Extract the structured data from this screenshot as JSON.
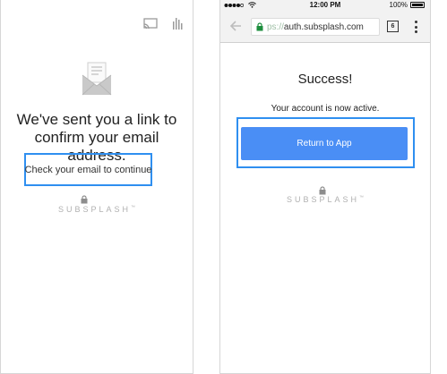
{
  "left_screen": {
    "headline": "We've sent you a link to confirm your email address.",
    "link_text": "Check your email to continue",
    "brand": "SUBSPLASH",
    "brand_mark": "™",
    "icons": [
      "cast-icon",
      "equalizer-icon",
      "envelope-icon",
      "lock-icon"
    ]
  },
  "right_screen": {
    "status_bar": {
      "time": "12:00 PM",
      "battery": "100%",
      "battery_level": 1.0
    },
    "browser": {
      "url_dim": "ps://",
      "url": "auth.subsplash.com",
      "tab_count": "6"
    },
    "title": "Success!",
    "subtitle": "Your account is now active.",
    "button_label": "Return to App",
    "brand": "SUBSPLASH",
    "brand_mark": "™"
  },
  "colors": {
    "accent_button": "#4a8ef5",
    "highlight_frame": "#2f8ff0",
    "secure_green": "#1e8e3e",
    "brand_gray": "#b0b0b0"
  }
}
